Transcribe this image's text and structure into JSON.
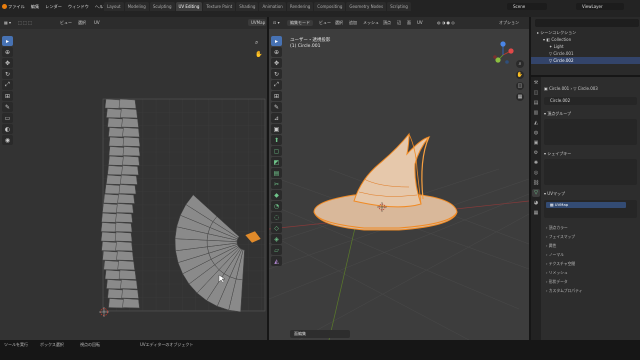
{
  "topbar": {
    "menus": [
      "ファイル",
      "編集",
      "レンダー",
      "ウィンドウ",
      "ヘルプ"
    ],
    "tabs": [
      "Layout",
      "Modeling",
      "Sculpting",
      "UV Editing",
      "Texture Paint",
      "Shading",
      "Animation",
      "Rendering",
      "Compositing",
      "Geometry Nodes",
      "Scripting"
    ],
    "scene_label": "Scene",
    "viewlayer_label": "ViewLayer"
  },
  "uv_editor": {
    "header_items": [
      "ビュー",
      "選択",
      "UV"
    ],
    "uvmap_chip": "UVMap",
    "tools": [
      "select",
      "cursor",
      "move",
      "rotate",
      "scale",
      "transform",
      "annotate",
      "grab",
      "relax",
      "pinch"
    ]
  },
  "viewport": {
    "header_items": [
      "ビュー",
      "選択",
      "追加",
      "メッシュ",
      "頂点",
      "辺",
      "面",
      "UV"
    ],
    "mode_label": "編集モード",
    "options_label": "オプション",
    "view_name": "ユーザー・透視投影",
    "object_name": "(1) Circle.001",
    "footer_label": "面編集"
  },
  "outliner": {
    "title": "シーンコレクション",
    "rows": [
      "Collection",
      "Light",
      "Circle.001",
      "Circle.002"
    ]
  },
  "properties": {
    "breadcrumb_obj": "Circle.001",
    "breadcrumb_mesh": "Circle.003",
    "mesh_name": "Circle.002",
    "sections": [
      "頂点グループ",
      "シェイプキー",
      "UVマップ",
      "頂点カラー",
      "フェイスマップ",
      "属性",
      "ノーマル",
      "テクスチャ空間",
      "リメッシュ",
      "形状データ",
      "カスタムプロパティ"
    ],
    "uvmap_item": "UVMap"
  },
  "statusbar": {
    "items": [
      "ツールを実行",
      "ボックス選択",
      "視点の回転",
      "UVエディターのオブジェクト"
    ]
  },
  "colors": {
    "accent": "#4772b3",
    "selection": "#f08a24",
    "uv_bg": "#333333",
    "viewport_bg": "#3d3d3d"
  }
}
